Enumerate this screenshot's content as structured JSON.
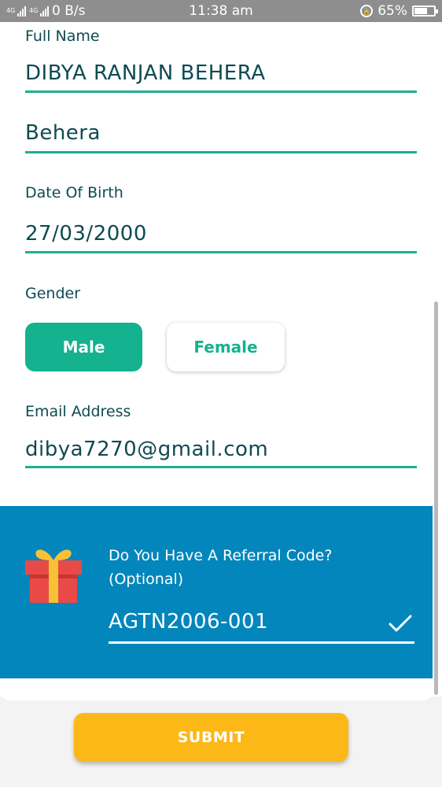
{
  "status_bar": {
    "network_1": "4G",
    "network_2": "4G",
    "speed": "0 B/s",
    "time": "11:38 am",
    "battery_percent": "65%",
    "battery_level": 0.65
  },
  "form": {
    "full_name": {
      "label": "Full Name",
      "value": "DIBYA RANJAN BEHERA"
    },
    "last_name": {
      "value": "Behera"
    },
    "dob": {
      "label": "Date Of Birth",
      "value": "27/03/2000"
    },
    "gender": {
      "label": "Gender",
      "options": [
        "Male",
        "Female"
      ],
      "selected": "Male"
    },
    "email": {
      "label": "Email Address",
      "value": "dibya7270@gmail.com"
    }
  },
  "referral": {
    "title_line1": "Do You Have A Referral Code?",
    "title_line2": "(Optional)",
    "code": "AGTN2006-001"
  },
  "submit_label": "SUBMIT",
  "colors": {
    "accent": "#14b28f",
    "referral_bg": "#0286bb",
    "submit": "#fbb817",
    "text": "#0f4a52"
  }
}
